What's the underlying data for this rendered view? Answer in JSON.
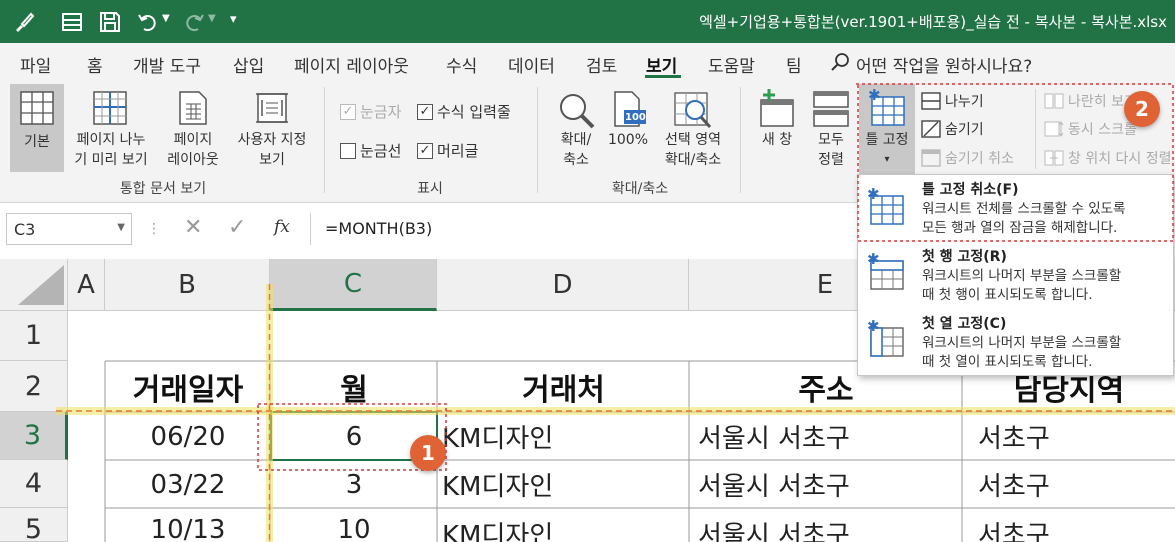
{
  "titlebar": {
    "document_title": "엑셀+기업용+통합본(ver.1901+배포용)_실습 전 - 복사본 - 복사본.xlsx",
    "qat_more": "▾"
  },
  "menu": {
    "items": [
      "파일",
      "홈",
      "개발 도구",
      "삽입",
      "페이지 레이아웃",
      "수식",
      "데이터",
      "검토",
      "보기",
      "도움말",
      "팀"
    ],
    "search_placeholder": "어떤 작업을 원하시나요?"
  },
  "ribbon": {
    "workbook_views": {
      "normal": "기본",
      "page_break_l1": "페이지 나누",
      "page_break_l2": "기 미리 보기",
      "page_layout_l1": "페이지",
      "page_layout_l2": "레이아웃",
      "custom_l1": "사용자 지정",
      "custom_l2": "보기",
      "group": "통합 문서 보기"
    },
    "show": {
      "ruler": "눈금자",
      "formula_bar": "수식 입력줄",
      "gridlines": "눈금선",
      "headings": "머리글",
      "group": "표시"
    },
    "zoom": {
      "zoom_l1": "확대/",
      "zoom_l2": "축소",
      "hundred": "100%",
      "hundred_icon": "100",
      "selection_l1": "선택 영역",
      "selection_l2": "확대/축소",
      "group": "확대/축소"
    },
    "window": {
      "new_window": "새 창",
      "arrange_l1": "모두",
      "arrange_l2": "정렬",
      "freeze_l1": "틀 고정",
      "freeze_caret": "▾",
      "split": "나누기",
      "hide": "숨기기",
      "unhide": "숨기기 취소",
      "side_by_side": "나란히 보기",
      "sync_scroll": "동시 스크롤",
      "reset_position": "창 위치 다시 정렬"
    }
  },
  "formula_bar": {
    "name_box": "C3",
    "fx": "fx",
    "formula": "=MONTH(B3)"
  },
  "sheet": {
    "columns": [
      "A",
      "B",
      "C",
      "D",
      "E"
    ],
    "rows": [
      "1",
      "2",
      "3",
      "4",
      "5"
    ],
    "headers": [
      "거래일자",
      "월",
      "거래처",
      "주소",
      "담당지역"
    ],
    "data": [
      [
        "06/20",
        "6",
        "KM디자인",
        "서울시 서초구",
        "서초구"
      ],
      [
        "03/22",
        "3",
        "KM디자인",
        "서울시 서초구",
        "서초구"
      ],
      [
        "10/13",
        "10",
        "KM디자인",
        "서울시 서초구",
        "서초구"
      ]
    ]
  },
  "dropdown": {
    "items": [
      {
        "title": "틀 고정 취소(F)",
        "desc": "워크시트 전체를 스크롤할 수 있도록\n모든 행과 열의 잠금을 해제합니다."
      },
      {
        "title": "첫 행 고정(R)",
        "desc": "워크시트의 나머지 부분을 스크롤할\n때 첫 행이 표시되도록 합니다."
      },
      {
        "title": "첫 열 고정(C)",
        "desc": "워크시트의 나머지 부분을 스크롤할\n때 첫 열이 표시되도록 합니다."
      }
    ]
  },
  "badges": {
    "one": "1",
    "two": "2"
  },
  "colors": {
    "excel_green": "#217346",
    "badge": "#e06336",
    "freeze_line": "#f0e060",
    "callout": "#d23a3a"
  }
}
